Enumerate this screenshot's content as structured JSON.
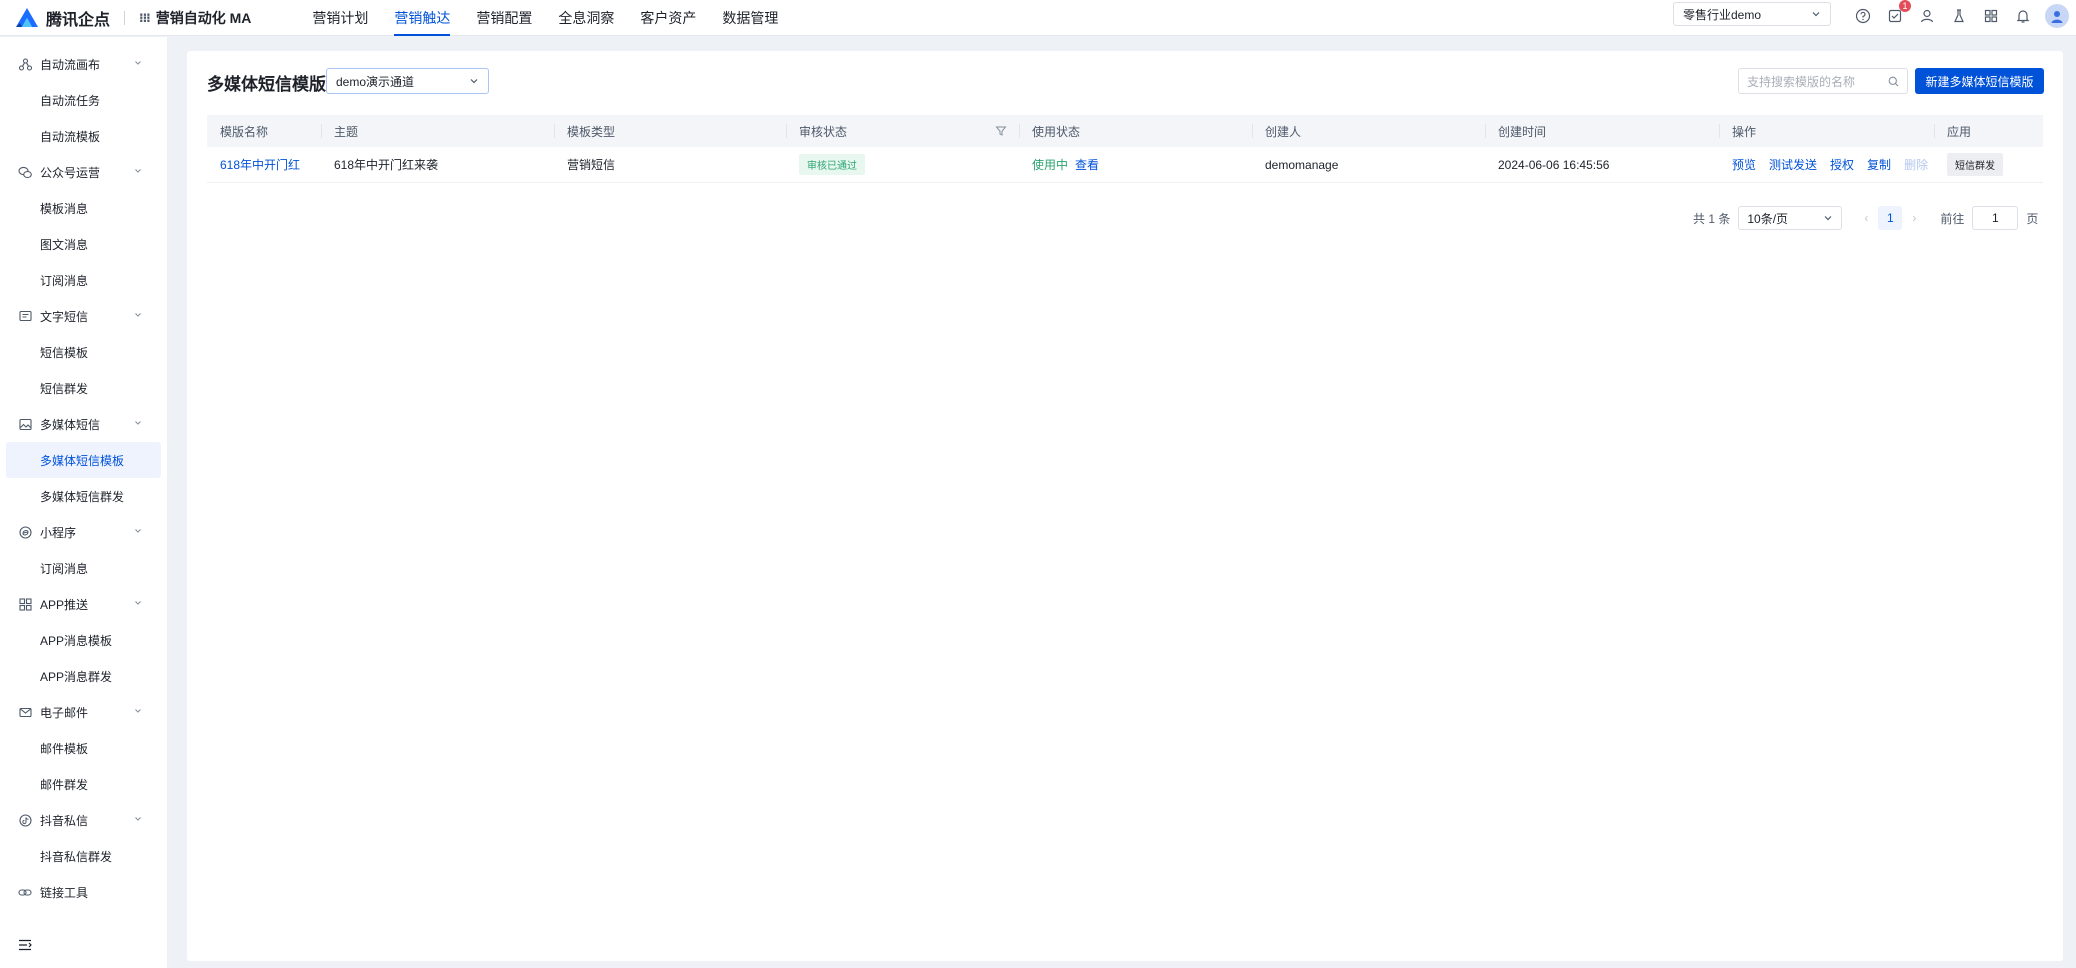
{
  "brand": {
    "logo_text": "腾讯企点",
    "product": "营销自动化 MA"
  },
  "topnav": [
    {
      "label": "营销计划",
      "active": false
    },
    {
      "label": "营销触达",
      "active": true
    },
    {
      "label": "营销配置",
      "active": false
    },
    {
      "label": "全息洞察",
      "active": false
    },
    {
      "label": "客户资产",
      "active": false
    },
    {
      "label": "数据管理",
      "active": false
    }
  ],
  "tenant": {
    "value": "零售行业demo"
  },
  "notifications": {
    "badge": "1"
  },
  "sidebar": [
    {
      "group": "自动流画布",
      "icon": "flow-icon",
      "items": [
        "自动流任务",
        "自动流模板"
      ]
    },
    {
      "group": "公众号运营",
      "icon": "wechat-icon",
      "items": [
        "模板消息",
        "图文消息",
        "订阅消息"
      ]
    },
    {
      "group": "文字短信",
      "icon": "message-icon",
      "items": [
        "短信模板",
        "短信群发"
      ]
    },
    {
      "group": "多媒体短信",
      "icon": "image-message-icon",
      "items": [
        "多媒体短信模板",
        "多媒体短信群发"
      ]
    },
    {
      "group": "小程序",
      "icon": "miniprogram-icon",
      "items": [
        "订阅消息"
      ]
    },
    {
      "group": "APP推送",
      "icon": "app-icon",
      "items": [
        "APP消息模板",
        "APP消息群发"
      ]
    },
    {
      "group": "电子邮件",
      "icon": "mail-icon",
      "items": [
        "邮件模板",
        "邮件群发"
      ]
    },
    {
      "group": "抖音私信",
      "icon": "douyin-icon",
      "items": [
        "抖音私信群发"
      ]
    },
    {
      "group": "链接工具",
      "icon": "link-icon",
      "items": []
    }
  ],
  "sidebar_active_item": "多媒体短信模板",
  "page": {
    "title": "多媒体短信模版",
    "channel": "demo演示通道",
    "search_placeholder": "支持搜索模版的名称",
    "new_button": "新建多媒体短信模版"
  },
  "table": {
    "columns": [
      "模版名称",
      "主题",
      "模板类型",
      "审核状态",
      "使用状态",
      "创建人",
      "创建时间",
      "操作",
      "应用"
    ],
    "rows": [
      {
        "name": "618年中开门红",
        "subject": "618年中开门红来袭",
        "type": "营销短信",
        "review_status": "审核已通过",
        "use_status": "使用中",
        "view_link": "查看",
        "creator": "demomanage",
        "created_at": "2024-06-06 16:45:56",
        "ops": [
          "预览",
          "测试发送",
          "授权",
          "复制"
        ],
        "disabled_op": "删除",
        "app_action": "短信群发"
      }
    ]
  },
  "pagination": {
    "total": "共 1 条",
    "page_size": "10条/页",
    "current": "1",
    "goto_label": "前往",
    "goto_value": "1",
    "page_unit": "页"
  }
}
